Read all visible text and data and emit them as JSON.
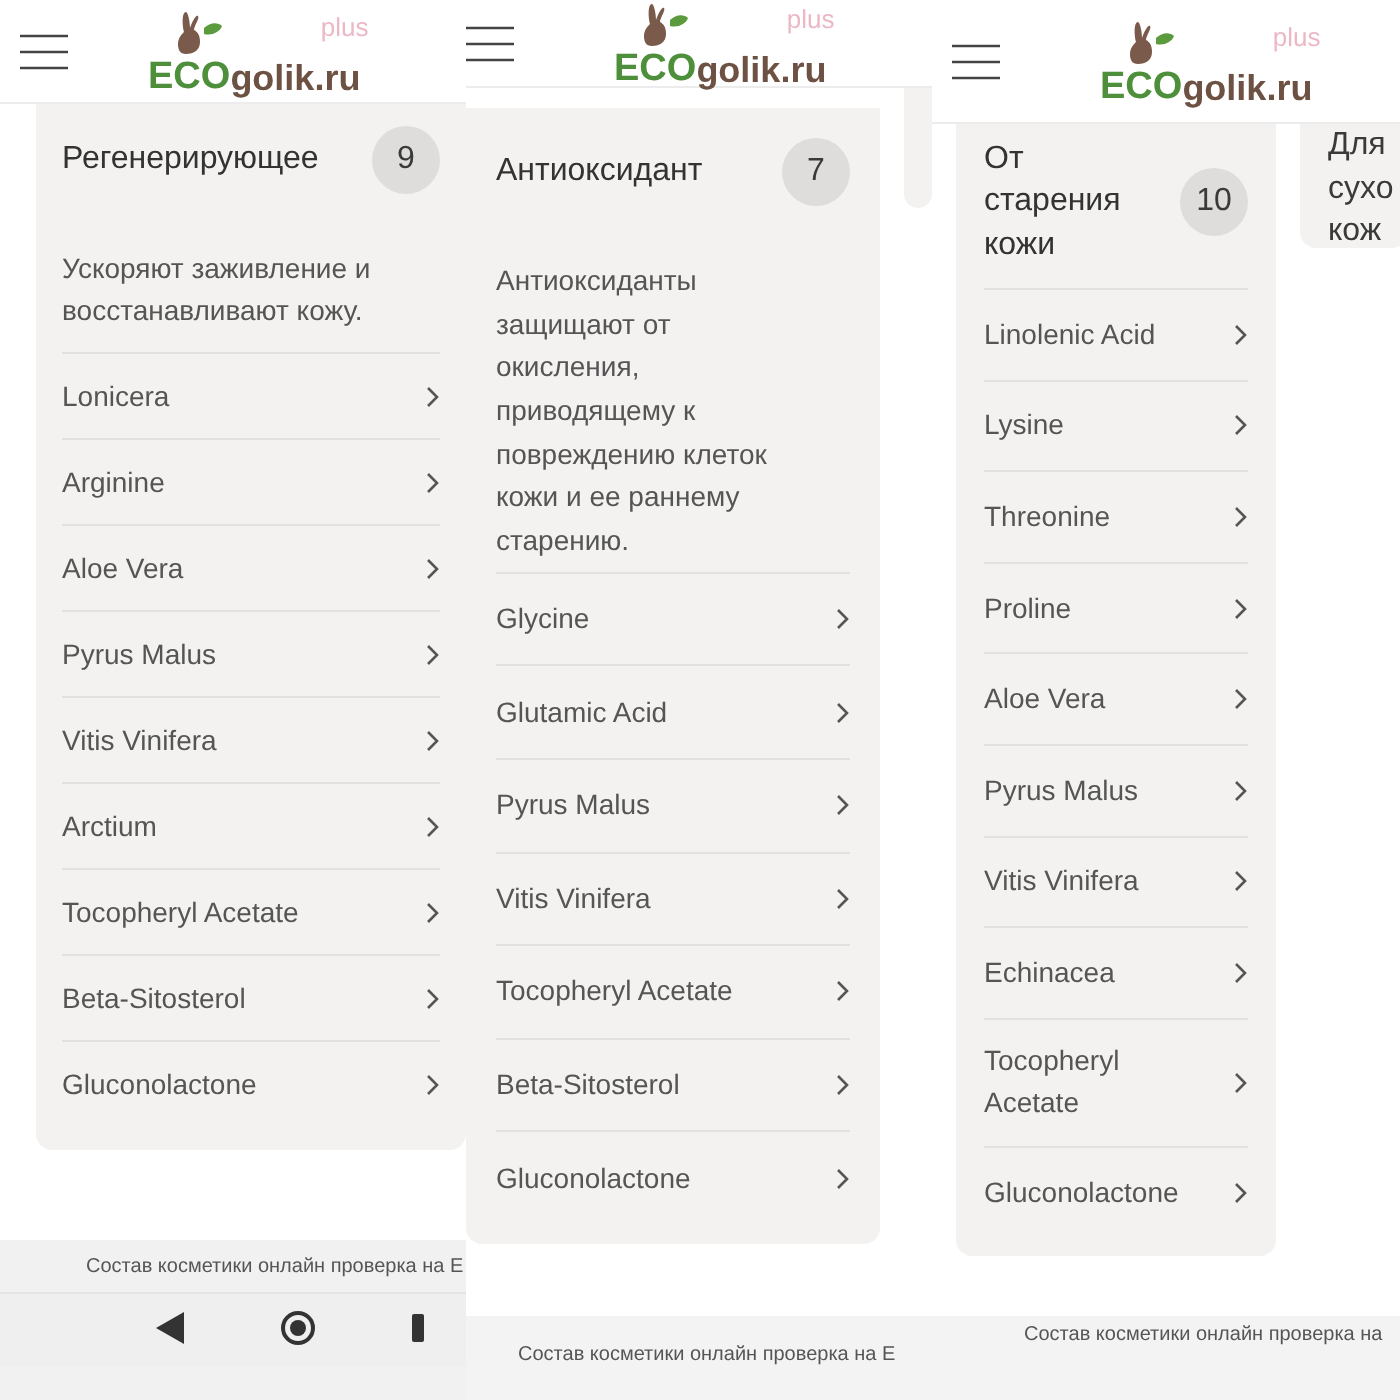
{
  "panels": [
    {
      "logo": {
        "eco": "ECO",
        "rest": "golik.ru",
        "sup": "plus"
      },
      "card": {
        "title": "Регенерирующее",
        "count": "9",
        "description": "Ускоряют заживление и восстанавливают кожу.",
        "items": [
          "Lonicera",
          "Arginine",
          "Aloe Vera",
          "Pyrus Malus",
          "Vitis Vinifera",
          "Arctium",
          "Tocopheryl Acetate",
          "Beta-Sitosterol",
          "Gluconolactone"
        ]
      },
      "footer": {
        "text": "Состав косметики онлайн проверка на E",
        "nav_bar": true
      }
    },
    {
      "logo": {
        "eco": "ECO",
        "rest": "golik.ru",
        "sup": "plus"
      },
      "card": {
        "title": "Антиоксидант",
        "count": "7",
        "description": "Антиоксиданты защищают от окисления, приводящему к повреждению клеток кожи и ее раннему старению.",
        "items": [
          "Glycine",
          "Glutamic Acid",
          "Pyrus Malus",
          "Vitis Vinifera",
          "Tocopheryl Acetate",
          "Beta-Sitosterol",
          "Gluconolactone"
        ]
      },
      "peek": {
        "kind": "blank"
      },
      "footer": {
        "text": "Состав косметики онлайн проверка на E"
      }
    },
    {
      "logo": {
        "eco": "ECO",
        "rest": "golik.ru",
        "sup": "plus"
      },
      "card": {
        "title": "От старения кожи",
        "count": "10",
        "items": [
          "Linolenic Acid",
          "Lysine",
          "Threonine",
          "Proline",
          "Aloe Vera",
          "Pyrus Malus",
          "Vitis Vinifera",
          "Echinacea",
          "Tocopheryl Acetate",
          "Gluconolactone"
        ]
      },
      "peek": {
        "kind": "titled",
        "title": "Для сухо кож"
      },
      "footer": {
        "text": "Состав косметики онлайн проверка на"
      }
    }
  ]
}
